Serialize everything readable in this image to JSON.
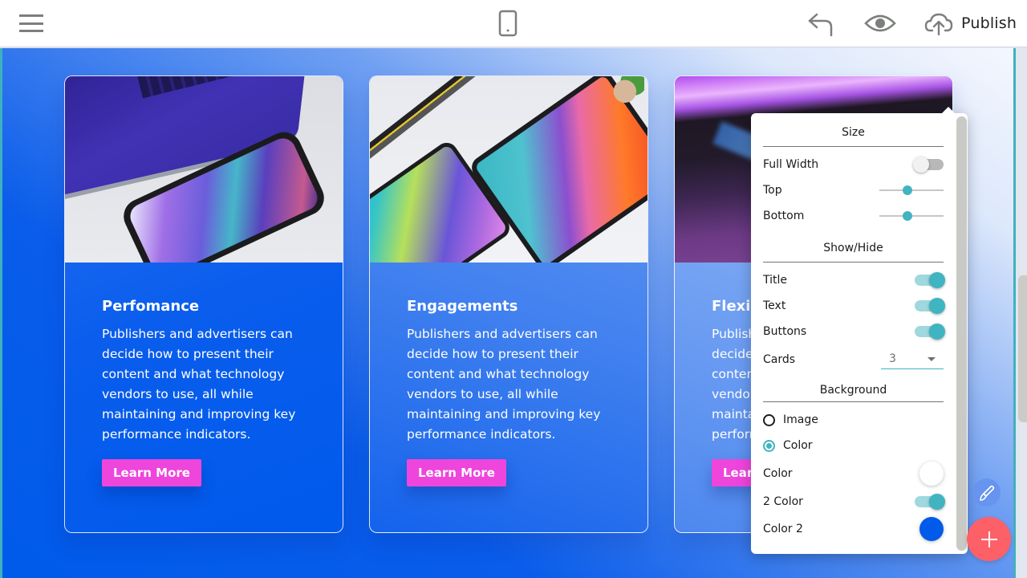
{
  "toolbar": {
    "menu_icon": "hamburger-menu-icon",
    "device_icon": "mobile-device-icon",
    "undo_icon": "undo-arrow-icon",
    "preview_icon": "eye-icon",
    "publish_icon": "cloud-upload-icon",
    "publish_label": "Publish"
  },
  "cards": [
    {
      "title": "Perfomance",
      "text": "Publishers and advertisers can decide how to present their content and what technology vendors to use, all while maintaining and improving key performance indicators.",
      "button": "Learn More",
      "image": "laptop-and-smartphone-photo"
    },
    {
      "title": "Engagements",
      "text": "Publishers and advertisers can decide how to present their content and what technology vendors to use, all while maintaining and improving key performance indicators.",
      "button": "Learn More",
      "image": "two-tablets-photo"
    },
    {
      "title": "Flexibility",
      "text": "Publishers and advertisers can decide how to present their content and what technology vendors to use, all while maintaining and improving key performance indicators.",
      "button": "Learn More",
      "image": "purple-desk-device-photo"
    }
  ],
  "panel": {
    "size_title": "Size",
    "full_width": {
      "label": "Full Width",
      "on": false
    },
    "top": {
      "label": "Top",
      "value_percent": 44
    },
    "bottom": {
      "label": "Bottom",
      "value_percent": 44
    },
    "showhide_title": "Show/Hide",
    "title_toggle": {
      "label": "Title",
      "on": true
    },
    "text_toggle": {
      "label": "Text",
      "on": true
    },
    "buttons_toggle": {
      "label": "Buttons",
      "on": true
    },
    "cards": {
      "label": "Cards",
      "value": "3"
    },
    "background_title": "Background",
    "bg_image": {
      "label": "Image",
      "checked": false
    },
    "bg_color": {
      "label": "Color",
      "checked": true
    },
    "color": {
      "label": "Color",
      "value": "#ffffff"
    },
    "two_color": {
      "label": "2 Color",
      "on": true
    },
    "color2": {
      "label": "Color 2",
      "value": "#005bea"
    }
  },
  "fabs": {
    "edit_icon": "paintbrush-icon",
    "add_icon": "plus-icon"
  },
  "colors": {
    "accent": "#40b4c1",
    "button": "#ee45dc",
    "add_fab": "#fd6067",
    "gradient_start": "#005bea",
    "gradient_end": "#ffffff"
  }
}
